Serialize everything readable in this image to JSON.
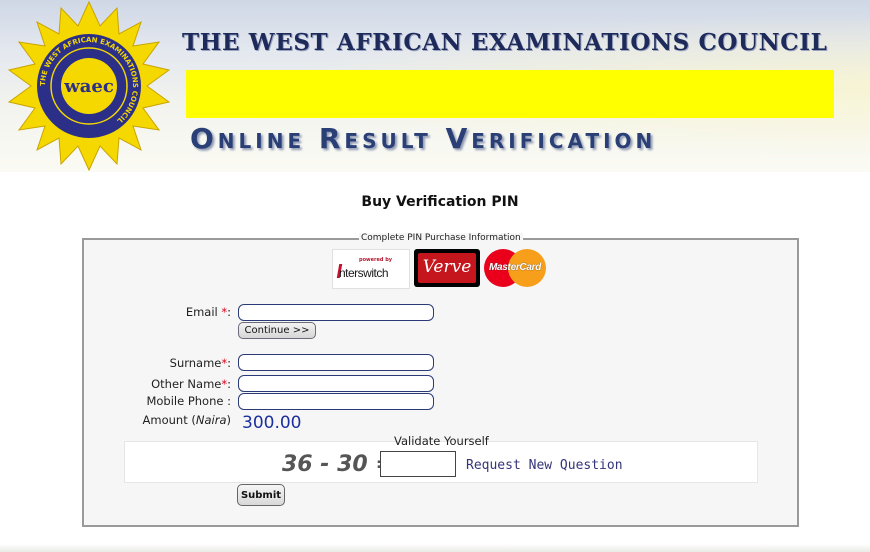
{
  "header": {
    "council_title": "THE WEST AFRICAN EXAMINATIONS COUNCIL",
    "app_title": "Online Result Verification",
    "logo_text": "waec",
    "logo_ring_text": "THE WEST AFRICAN EXAMINATIONS COUNCIL",
    "colors": {
      "banner_yellow": "#ffff00",
      "title_navy": "#1d2a5a",
      "logo_star": "#f5d800",
      "logo_disc": "#2b2f87"
    }
  },
  "page": {
    "heading": "Buy Verification PIN"
  },
  "form": {
    "legend": "Complete PIN Purchase Information",
    "payment_logos": {
      "interswitch_powered_by": "powered by",
      "interswitch_name": "nterswitch",
      "verve": "Verve",
      "mastercard": "MasterCard"
    },
    "email": {
      "label": "Email ",
      "req": "*",
      "suffix": ":",
      "value": "",
      "placeholder": ""
    },
    "continue_label": "Continue >>",
    "surname": {
      "label": "Surname",
      "req": "*",
      "suffix": ":",
      "value": ""
    },
    "other_name": {
      "label": "Other Name",
      "req": "*",
      "suffix": ":",
      "value": ""
    },
    "mobile_phone": {
      "label": "Mobile Phone :",
      "value": ""
    },
    "amount": {
      "label": "Amount (",
      "unit": "Naira",
      "label_end": ")",
      "value": "300.00"
    },
    "validate": {
      "title": "Validate Yourself",
      "question": "36 - 30 =",
      "answer": "",
      "new_question": "Request New Question"
    },
    "submit_label": "Submit"
  }
}
